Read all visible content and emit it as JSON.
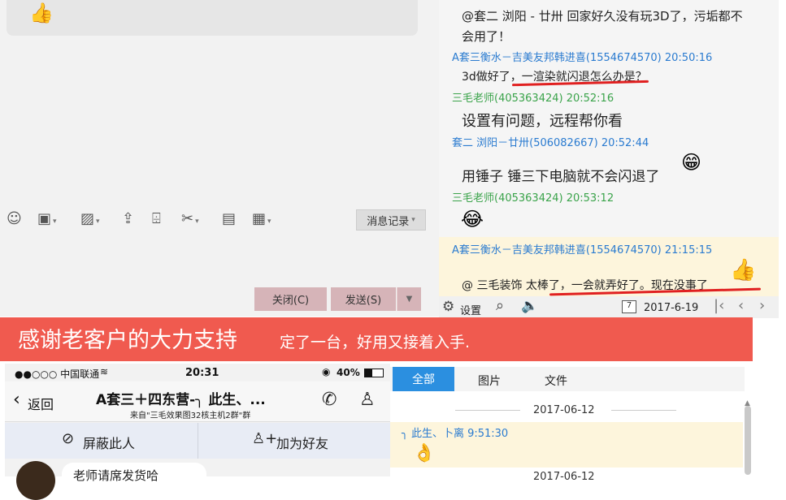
{
  "left": {
    "toolbar_history": "消息记录",
    "close_label": "关闭(C)",
    "send_label": "发送(S)"
  },
  "chat": {
    "messages": [
      {
        "text": "@套二 浏阳 - 廿卅 回家好久没有玩3D了，污垢都不"
      },
      {
        "text": "会用了！"
      },
      {
        "sender": "A套三衡水－吉美友邦韩进喜(1554674570) 20:50:16",
        "text": "3d做好了，一渲染就闪退怎么办是？"
      },
      {
        "sender": "三毛老师(405363424) 20:52:16",
        "text": "设置有问题，远程帮你看"
      },
      {
        "sender": "套二 浏阳－廿卅(506082667) 20:52:44",
        "text": "用锤子 锤三下电脑就不会闪退了"
      },
      {
        "sender": "三毛老师(405363424) 20:53:12"
      },
      {
        "sender": "A套三衡水－吉美友邦韩进喜(1554674570) 21:15:15",
        "text": "@ 三毛装饰 太棒了，一会就弄好了。现在没事了"
      }
    ],
    "settings_label": "设置",
    "date": "2017-6-19"
  },
  "banner": {
    "main": "感谢老客户的大力支持",
    "sub": "定了一台，好用又接着入手."
  },
  "phone": {
    "carrier": "●●○○○ 中国联通",
    "time": "20:31",
    "battery": "40%",
    "back_label": "返回",
    "title": "A套三＋四东营-╮ 此生、...",
    "subtitle": "来自\"三毛效果图32核主机2群\"群",
    "block_label": "屏蔽此人",
    "add_friend_label": "加为好友",
    "preview_text": "老师请席发货哈"
  },
  "files": {
    "tab_all": "全部",
    "tab_images": "图片",
    "tab_files": "文件",
    "date1": "2017-06-12",
    "message_sender": "╮ 此生、卜离 9:51:30",
    "date2": "2017-06-12"
  }
}
